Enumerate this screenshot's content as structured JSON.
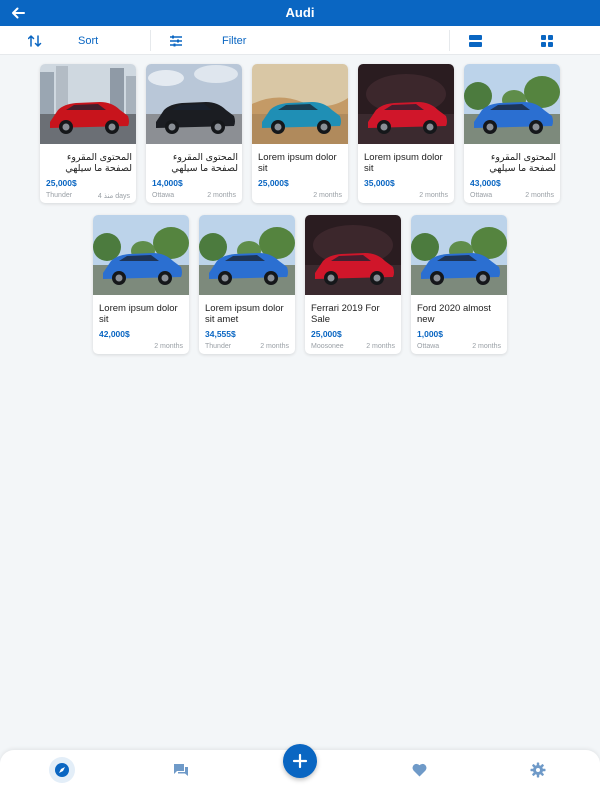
{
  "appbar": {
    "title": "Audi",
    "back_icon": "arrow-left-icon"
  },
  "toolbar": {
    "sort_label": "Sort",
    "filter_label": "Filter",
    "sort_icon": "sort-arrows-icon",
    "filter_icon": "sliders-icon",
    "list_view_icon": "list-view-icon",
    "grid_view_icon": "grid-view-icon"
  },
  "listings": [
    {
      "title": "المحتوى المقروء لصفحة ما سيلهي",
      "price": "25,000$",
      "location": "Thunder",
      "time": "منذ 4 days",
      "rtl": true,
      "car_color": "#c8141c",
      "scene": "city"
    },
    {
      "title": "المحتوى المقروء لصفحة ما سيلهي",
      "price": "14,000$",
      "location": "Ottawa",
      "time": "2 months",
      "rtl": true,
      "car_color": "#1b1d22",
      "scene": "cloudy"
    },
    {
      "title": "Lorem ipsum dolor sit",
      "price": "25,000$",
      "location": "",
      "time": "2 months",
      "rtl": false,
      "car_color": "#1f8fb5",
      "scene": "desert"
    },
    {
      "title": "Lorem ipsum dolor sit",
      "price": "35,000$",
      "location": "",
      "time": "2 months",
      "rtl": false,
      "car_color": "#d0162a",
      "scene": "dark"
    },
    {
      "title": "المحتوى المقروء لصفحة ما سيلهي",
      "price": "43,000$",
      "location": "Ottawa",
      "time": "2 months",
      "rtl": true,
      "car_color": "#2b6fd1",
      "scene": "park"
    },
    {
      "title": "Lorem ipsum dolor sit",
      "price": "42,000$",
      "location": "",
      "time": "2 months",
      "rtl": false,
      "car_color": "#2b6fd1",
      "scene": "park"
    },
    {
      "title": "Lorem ipsum dolor sit amet",
      "price": "34,555$",
      "location": "Thunder",
      "time": "2 months",
      "rtl": false,
      "car_color": "#2b6fd1",
      "scene": "park"
    },
    {
      "title": "Ferrari 2019 For Sale",
      "price": "25,000$",
      "location": "Moosonee",
      "time": "2 months",
      "rtl": false,
      "car_color": "#d0162a",
      "scene": "dark"
    },
    {
      "title": "Ford 2020 almost new",
      "price": "1,000$",
      "location": "Ottawa",
      "time": "2 months",
      "rtl": false,
      "car_color": "#2b6fd1",
      "scene": "park"
    }
  ],
  "bottomnav": {
    "items": [
      {
        "icon": "compass-icon",
        "active": true
      },
      {
        "icon": "chat-icon",
        "active": false
      },
      {
        "icon": "heart-icon",
        "active": false
      },
      {
        "icon": "gear-icon",
        "active": false
      }
    ],
    "fab_icon": "plus-icon"
  },
  "colors": {
    "primary": "#0a66c2",
    "background": "#f3f6f8",
    "muted": "#9aa0a6"
  }
}
